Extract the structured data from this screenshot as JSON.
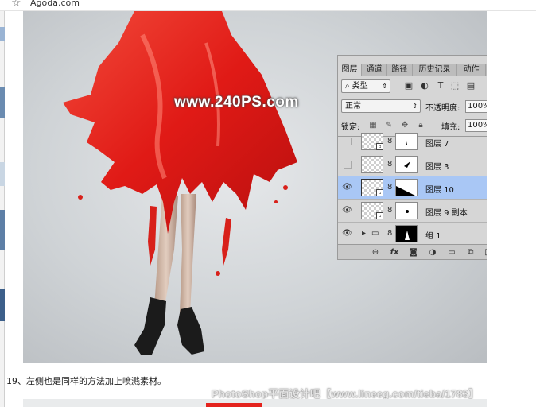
{
  "browser": {
    "tab_title": "Agoda.com"
  },
  "photo": {
    "watermark": "www.240PS.com"
  },
  "ps_panel": {
    "tabs": [
      "图层",
      "通道",
      "路径",
      "历史记录",
      "动作"
    ],
    "filter": {
      "value": "类型"
    },
    "blend": {
      "mode": "正常",
      "opacity_label": "不透明度:",
      "opacity": "100%"
    },
    "lock": {
      "label": "锁定:",
      "fill_label": "填充:",
      "fill": "100%"
    },
    "layers": [
      {
        "name": "图层 7",
        "visible": false,
        "selected": false
      },
      {
        "name": "图层 3",
        "visible": false,
        "selected": false
      },
      {
        "name": "图层 10",
        "visible": true,
        "selected": true
      },
      {
        "name": "图层 9 副本",
        "visible": true,
        "selected": false
      },
      {
        "name": "组 1",
        "visible": true,
        "selected": false
      }
    ]
  },
  "caption": "19、左侧也是同样的方法加上喷溅素材。",
  "footer_watermark": "PhotoShop平面设计吧【www.lineeg.com/tieba/1783】",
  "colors": {
    "accent_selected": "#a9c7f5",
    "dress_red": "#e8201c",
    "panel_bg": "#d6d6d6"
  }
}
